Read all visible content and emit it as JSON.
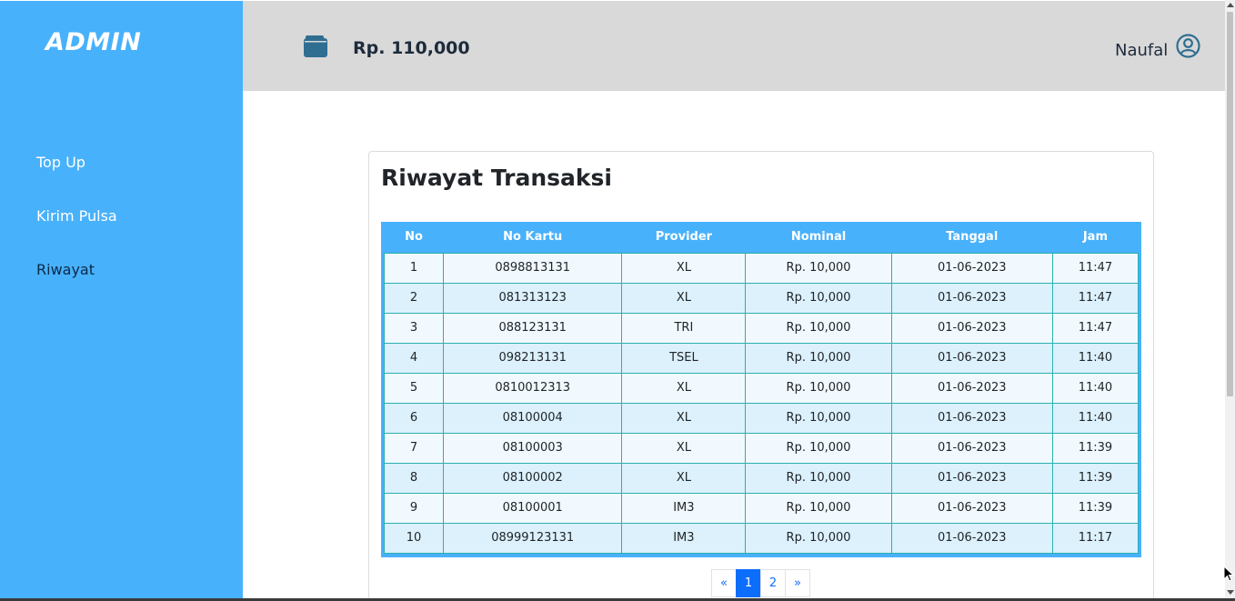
{
  "sidebar": {
    "brand": "ADMIN",
    "items": [
      {
        "label": "Top Up"
      },
      {
        "label": "Kirim Pulsa"
      },
      {
        "label": "Riwayat"
      }
    ]
  },
  "header": {
    "balance": "Rp. 110,000",
    "username": "Naufal",
    "wallet_icon": "wallet-icon",
    "user_icon": "user-circle-icon"
  },
  "main": {
    "title": "Riwayat Transaksi",
    "columns": [
      "No",
      "No Kartu",
      "Provider",
      "Nominal",
      "Tanggal",
      "Jam"
    ],
    "rows": [
      [
        "1",
        "0898813131",
        "XL",
        "Rp. 10,000",
        "01-06-2023",
        "11:47"
      ],
      [
        "2",
        "081313123",
        "XL",
        "Rp. 10,000",
        "01-06-2023",
        "11:47"
      ],
      [
        "3",
        "088123131",
        "TRI",
        "Rp. 10,000",
        "01-06-2023",
        "11:47"
      ],
      [
        "4",
        "098213131",
        "TSEL",
        "Rp. 10,000",
        "01-06-2023",
        "11:40"
      ],
      [
        "5",
        "0810012313",
        "XL",
        "Rp. 10,000",
        "01-06-2023",
        "11:40"
      ],
      [
        "6",
        "08100004",
        "XL",
        "Rp. 10,000",
        "01-06-2023",
        "11:40"
      ],
      [
        "7",
        "08100003",
        "XL",
        "Rp. 10,000",
        "01-06-2023",
        "11:39"
      ],
      [
        "8",
        "08100002",
        "XL",
        "Rp. 10,000",
        "01-06-2023",
        "11:39"
      ],
      [
        "9",
        "08100001",
        "IM3",
        "Rp. 10,000",
        "01-06-2023",
        "11:39"
      ],
      [
        "10",
        "08999123131",
        "IM3",
        "Rp. 10,000",
        "01-06-2023",
        "11:17"
      ]
    ],
    "pagination": {
      "prev": "«",
      "pages": [
        "1",
        "2"
      ],
      "current": "1",
      "next": "»"
    }
  },
  "colors": {
    "sidebar": "#48b1fb",
    "header": "#d9d9d9",
    "active_nav": "#0b2a47",
    "row_border": "#2ab0b0",
    "pagination_active": "#0d6efd"
  }
}
